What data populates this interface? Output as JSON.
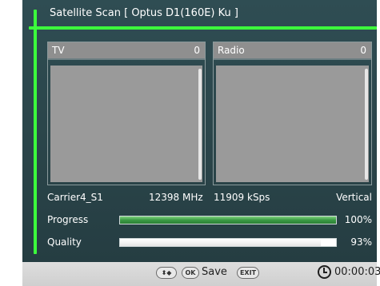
{
  "header": {
    "title": "Satellite Scan [ Optus D1(160E) Ku ]"
  },
  "panels": {
    "tv": {
      "label": "TV",
      "count": "0"
    },
    "radio": {
      "label": "Radio",
      "count": "0"
    }
  },
  "info": {
    "carrier": "Carrier4_S1",
    "frequency": "12398 MHz",
    "symbol_rate": "11909 kSps",
    "polarization": "Vertical"
  },
  "meters": {
    "progress": {
      "label": "Progress",
      "value_text": "100%",
      "fraction": 1.0
    },
    "quality": {
      "label": "Quality",
      "value_text": "93%",
      "fraction": 0.93
    }
  },
  "footer": {
    "nav_key": "⬍◆",
    "ok_key": "OK",
    "save_label": "Save",
    "exit_key": "EXIT",
    "elapsed_time": "00:00:03"
  },
  "colors": {
    "accent": "#3cff3c",
    "screen_bg": "#2f4d53",
    "panel_bg": "#9a9a9a",
    "progress_fill": "#3a9a44"
  },
  "icons": {
    "nav": "navigation-arrows-icon",
    "ok": "ok-key-icon",
    "exit": "exit-key-icon",
    "clock": "clock-icon"
  }
}
